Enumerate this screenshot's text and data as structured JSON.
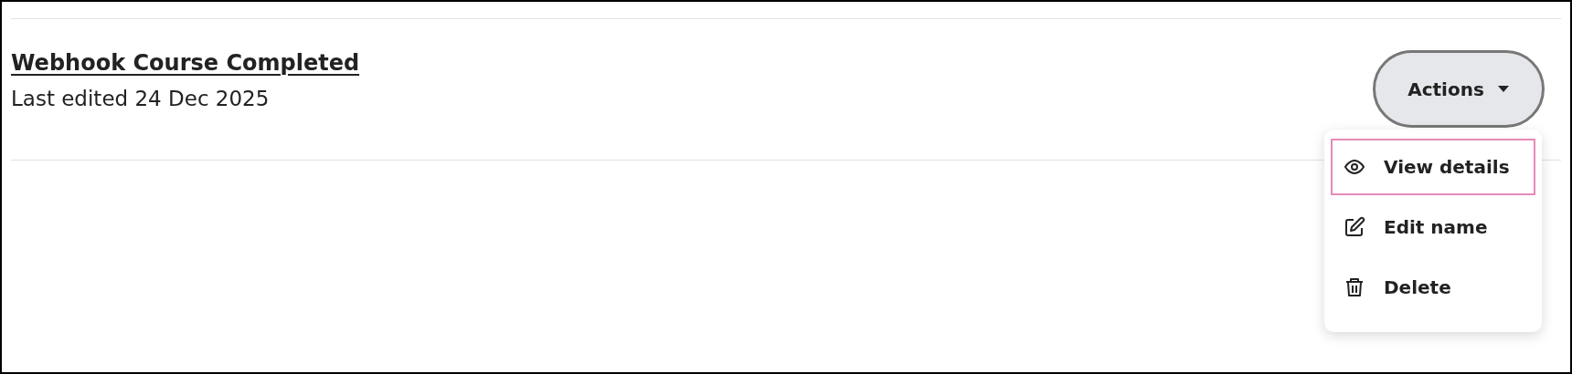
{
  "item": {
    "title": "Webhook Course Completed",
    "subtitle": "Last edited 24 Dec 2025"
  },
  "actions_button": {
    "label": "Actions",
    "expanded": true
  },
  "menu": [
    {
      "kind": "view",
      "label": "View details",
      "selected": true
    },
    {
      "kind": "edit",
      "label": "Edit name",
      "selected": false
    },
    {
      "kind": "delete",
      "label": "Delete",
      "selected": false
    }
  ]
}
